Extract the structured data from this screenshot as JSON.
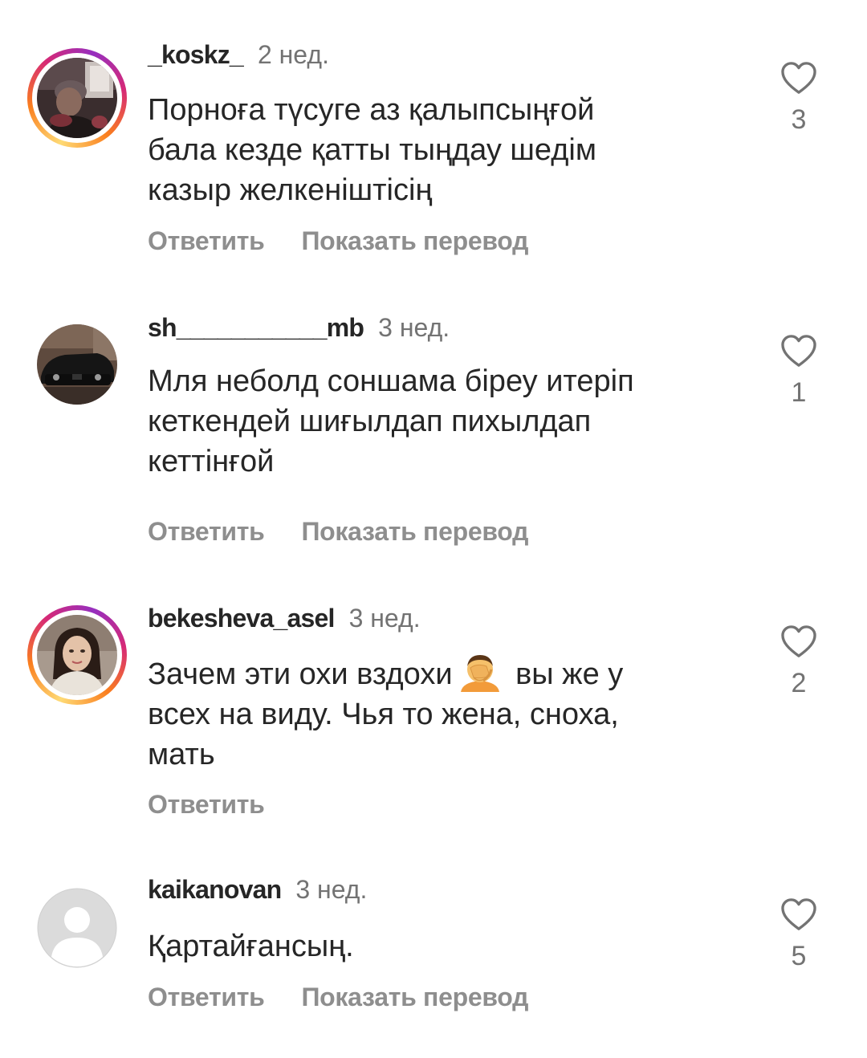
{
  "comments": [
    {
      "username": "_koskz_",
      "time": "2 нед.",
      "text": "Порноға түсуге аз қалыпсыңғой\nбала кезде қатты тыңдау шедім\nказыр желкеніштісің",
      "reply_label": "Ответить",
      "translate_label": "Показать перевод",
      "likes": "3",
      "avatar_icon": "user-photo-avatar",
      "story_ring": true
    },
    {
      "username": "sh___________mb",
      "time": "3 нед.",
      "text": "Мля неболд соншама біреу итеріп\nкеткендей шиғылдап пихылдап\nкеттінғой",
      "reply_label": "Ответить",
      "translate_label": "Показать перевод",
      "likes": "1",
      "avatar_icon": "car-photo-avatar",
      "story_ring": false
    },
    {
      "username": "bekesheva_asel",
      "time": "3 нед.",
      "text_before": "Зачем эти охи вздохи",
      "emoji_icon": "facepalm-emoji-icon",
      "text_after": " вы же у\nвсех на виду. Чья то жена, сноха,\nмать",
      "reply_label": "Ответить",
      "likes": "2",
      "avatar_icon": "woman-photo-avatar",
      "story_ring": true
    },
    {
      "username": "kaikanovan",
      "time": "3 нед.",
      "text": "Қартайғансың.",
      "reply_label": "Ответить",
      "translate_label": "Показать перевод",
      "likes": "5",
      "avatar_icon": "default-user-avatar",
      "story_ring": false
    }
  ],
  "colors": {
    "text": "#262626",
    "secondary": "#737373",
    "action": "#8e8e8e"
  }
}
